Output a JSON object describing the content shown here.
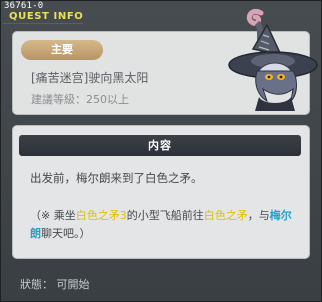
{
  "window": {
    "quest_id": "36761-0",
    "title": "QUEST INFO"
  },
  "quest": {
    "category_badge": "主要",
    "name": "[痛苦迷宫]驶向黑太阳",
    "level_requirement": "建議等級：250以上"
  },
  "content": {
    "header": "内容",
    "description": "出发前，梅尔朗来到了白色之矛。",
    "note": {
      "prefix": "（※ 乘坐",
      "term1": "白色之矛3",
      "middle1": "的小型飞船前往",
      "term2": "白色之矛",
      "middle2": "，与",
      "npc": "梅尔朗",
      "suffix": "聊天吧。）"
    }
  },
  "footer": {
    "status": "狀態： 可開始"
  },
  "colors": {
    "title_yellow": "#e7e15a",
    "highlight_yellow": "#e0c100",
    "highlight_blue": "#2aa0c9",
    "badge_tan": "#c9aa78"
  }
}
